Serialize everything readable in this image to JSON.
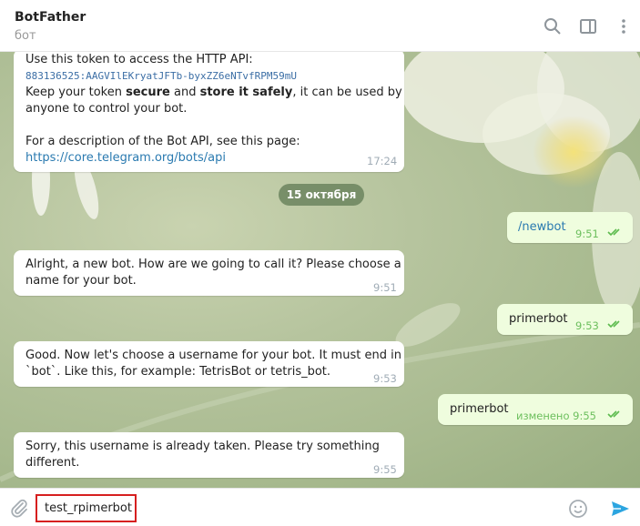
{
  "header": {
    "title": "BotFather",
    "subtitle": "бот",
    "icons": [
      "search-icon",
      "sidebar-panel-icon",
      "more-vertical-icon"
    ]
  },
  "messages": [
    {
      "direction": "in",
      "line1": "Use this token to access the HTTP API:",
      "token": "883136525:AAGVIlEKryatJFTb-byxZZ6eNTvfRPM59mU",
      "line3_a": "Keep your token ",
      "line3_b": "secure",
      "line3_c": " and ",
      "line3_d": "store it safely",
      "line3_e": ", it can be used by",
      "line4": "anyone to control your bot.",
      "line5": "For a description of the Bot API, see this page:",
      "link": "https://core.telegram.org/bots/api",
      "time": "17:24"
    },
    {
      "direction": "out",
      "text": "/newbot",
      "time": "9:51"
    },
    {
      "direction": "in",
      "text": "Alright, a new bot. How are we going to call it? Please choose a\nname for your bot.",
      "time": "9:51"
    },
    {
      "direction": "out",
      "text": "primerbot",
      "time": "9:53"
    },
    {
      "direction": "in",
      "text": "Good. Now let's choose a username for your bot. It must end in\n`bot`. Like this, for example: TetrisBot or tetris_bot.",
      "time": "9:53"
    },
    {
      "direction": "out",
      "text": "primerbot",
      "time": "изменено 9:55"
    },
    {
      "direction": "in",
      "text": "Sorry, this username is already taken. Please try something\ndifferent.",
      "time": "9:55"
    }
  ],
  "date_separator": "15 октября",
  "composer": {
    "input_value": "test_rpimerbot",
    "icons": [
      "paperclip-icon",
      "emoji-icon",
      "send-icon"
    ]
  },
  "colors": {
    "incoming_bubble": "#ffffff",
    "outgoing_bubble": "#effdde",
    "highlight_border": "#d61f1f",
    "send_button": "#2ca5e0"
  }
}
